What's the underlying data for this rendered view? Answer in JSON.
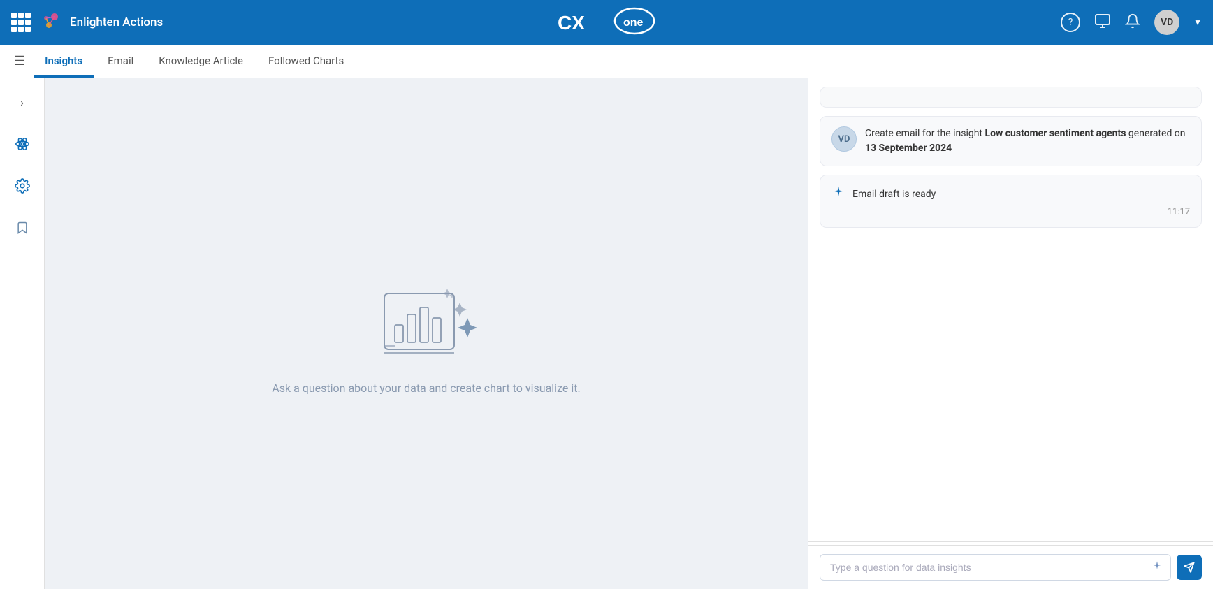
{
  "brand": {
    "name": "Enlighten Actions",
    "app_title": "CXone"
  },
  "topnav": {
    "user_initials": "VD",
    "help_icon": "?",
    "monitor_icon": "▣",
    "bell_icon": "🔔"
  },
  "subnav": {
    "tabs": [
      {
        "id": "insights",
        "label": "Insights",
        "active": true
      },
      {
        "id": "email",
        "label": "Email",
        "active": false
      },
      {
        "id": "knowledge-article",
        "label": "Knowledge Article",
        "active": false
      },
      {
        "id": "followed-charts",
        "label": "Followed Charts",
        "active": false
      }
    ]
  },
  "sidebar": {
    "items": [
      {
        "id": "atom",
        "icon": "⚛"
      },
      {
        "id": "gear",
        "icon": "⚙"
      },
      {
        "id": "bookmark",
        "icon": "🔖"
      }
    ]
  },
  "content": {
    "empty_state_text": "Ask a question about your data and create chart to visualize it."
  },
  "chat": {
    "messages": [
      {
        "type": "user",
        "avatar": "VD",
        "text_plain": "Create email for the insight ",
        "text_bold1": "Low customer sentiment agents",
        "text_mid": " generated on ",
        "text_bold2": "13 September 2024"
      },
      {
        "type": "ai",
        "text": "Email draft is ready",
        "timestamp": "11:17"
      }
    ],
    "input_placeholder": "Type a question for data insights"
  }
}
